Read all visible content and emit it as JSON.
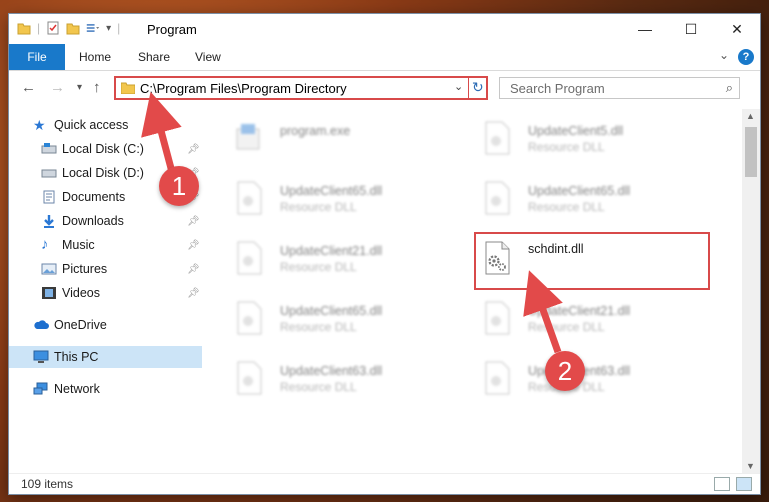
{
  "window": {
    "title": "Program"
  },
  "ribbon": {
    "file": "File",
    "home": "Home",
    "share": "Share",
    "view": "View",
    "help": "?"
  },
  "address": {
    "path": "C:\\Program Files\\Program Directory"
  },
  "search": {
    "placeholder": "Search Program"
  },
  "sidebar": {
    "items": [
      {
        "label": "Quick access",
        "icon": "star-icon"
      },
      {
        "label": "Local Disk (C:)",
        "icon": "drive-icon"
      },
      {
        "label": "Local Disk (D:)",
        "icon": "drive-icon"
      },
      {
        "label": "Documents",
        "icon": "documents-icon"
      },
      {
        "label": "Downloads",
        "icon": "download-icon"
      },
      {
        "label": "Music",
        "icon": "music-icon"
      },
      {
        "label": "Pictures",
        "icon": "pictures-icon"
      },
      {
        "label": "Videos",
        "icon": "videos-icon"
      },
      {
        "label": "OneDrive",
        "icon": "cloud-icon"
      },
      {
        "label": "This PC",
        "icon": "computer-icon"
      },
      {
        "label": "Network",
        "icon": "network-icon"
      }
    ]
  },
  "files": [
    {
      "name": "program.exe",
      "type": ""
    },
    {
      "name": "UpdateClient5.dll",
      "type": "Resource DLL"
    },
    {
      "name": "UpdateClient65.dll",
      "type": "Resource DLL"
    },
    {
      "name": "UpdateClient65.dll",
      "type": "Resource DLL"
    },
    {
      "name": "UpdateClient21.dll",
      "type": "Resource DLL"
    },
    {
      "name": "schdint.dll",
      "type": ""
    },
    {
      "name": "UpdateClient65.dll",
      "type": "Resource DLL"
    },
    {
      "name": "UpdateClient21.dll",
      "type": "Resource DLL"
    },
    {
      "name": "UpdateClient63.dll",
      "type": "Resource DLL"
    },
    {
      "name": "UpdateClient63.dll",
      "type": "Resource DLL"
    }
  ],
  "status": {
    "count": "109 items"
  },
  "callouts": {
    "one": "1",
    "two": "2"
  },
  "colors": {
    "accent": "#1979ca",
    "highlight": "#d84a4a"
  }
}
